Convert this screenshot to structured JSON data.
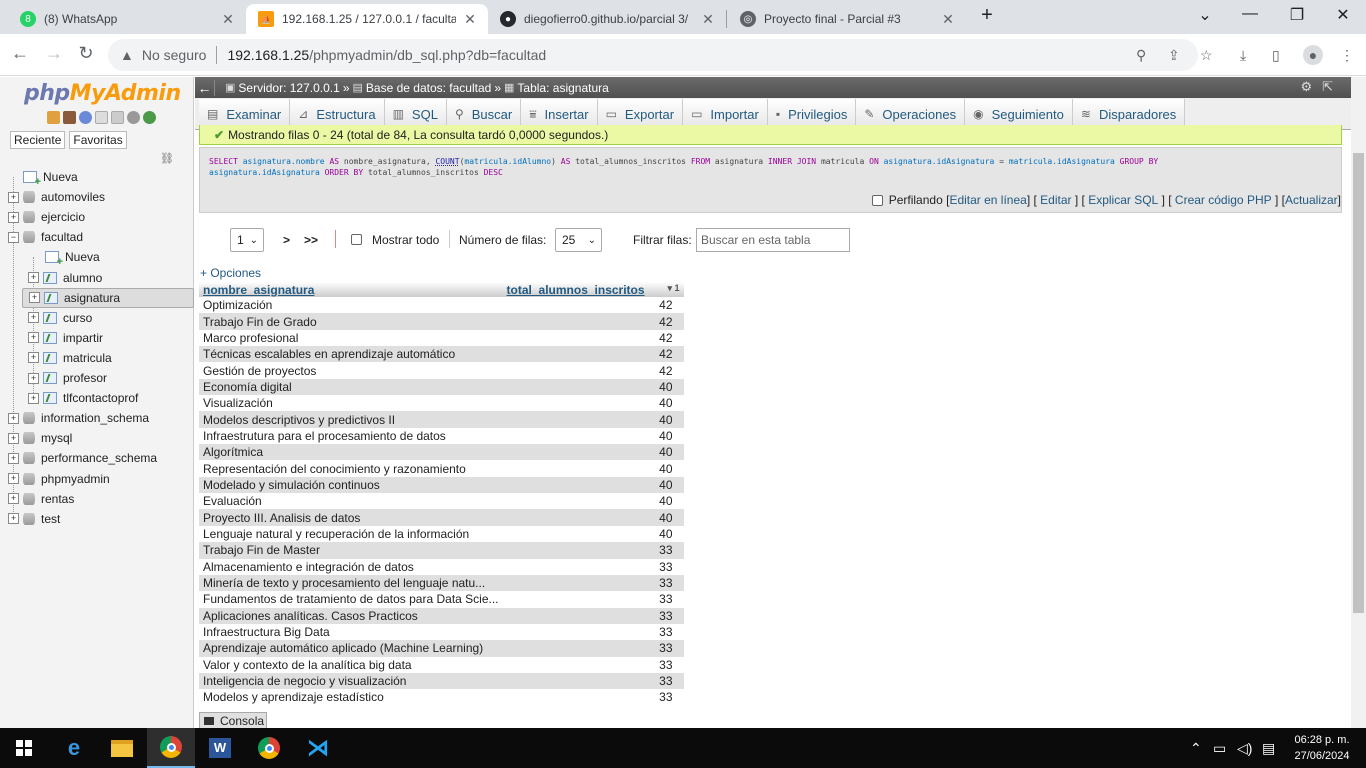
{
  "browser": {
    "tabs": [
      {
        "title": "(8) WhatsApp",
        "icon": "whatsapp-icon"
      },
      {
        "title": "192.168.1.25 / 127.0.0.1 / faculta",
        "icon": "phpmyadmin-icon"
      },
      {
        "title": "diegofierro0.github.io/parcial 3/",
        "icon": "github-icon"
      },
      {
        "title": "Proyecto final - Parcial #3",
        "icon": "globe-icon"
      }
    ],
    "new_tab": "+",
    "address": {
      "security": "No seguro",
      "host": "192.168.1.25",
      "path": "/phpmyadmin/db_sql.php?db=facultad"
    }
  },
  "sidebar": {
    "logo_php": "php",
    "logo_my": "MyAdmin",
    "recent_label": "Reciente",
    "favorites_label": "Favoritas",
    "items": [
      {
        "label": "Nueva",
        "level": 0,
        "kind": "new"
      },
      {
        "label": "automoviles",
        "level": 0,
        "kind": "db"
      },
      {
        "label": "ejercicio",
        "level": 0,
        "kind": "db"
      },
      {
        "label": "facultad",
        "level": 0,
        "kind": "db"
      },
      {
        "label": "Nueva",
        "level": 1,
        "kind": "new"
      },
      {
        "label": "alumno",
        "level": 1,
        "kind": "table"
      },
      {
        "label": "asignatura",
        "level": 1,
        "kind": "table"
      },
      {
        "label": "curso",
        "level": 1,
        "kind": "table"
      },
      {
        "label": "impartir",
        "level": 1,
        "kind": "table"
      },
      {
        "label": "matricula",
        "level": 1,
        "kind": "table"
      },
      {
        "label": "profesor",
        "level": 1,
        "kind": "table"
      },
      {
        "label": "tlfcontactoprof",
        "level": 1,
        "kind": "table"
      },
      {
        "label": "information_schema",
        "level": 0,
        "kind": "db"
      },
      {
        "label": "mysql",
        "level": 0,
        "kind": "db"
      },
      {
        "label": "performance_schema",
        "level": 0,
        "kind": "db"
      },
      {
        "label": "phpmyadmin",
        "level": 0,
        "kind": "db"
      },
      {
        "label": "rentas",
        "level": 0,
        "kind": "db"
      },
      {
        "label": "test",
        "level": 0,
        "kind": "db"
      }
    ]
  },
  "breadcrumb": {
    "server": "Servidor: 127.0.0.1",
    "database": "Base de datos: facultad",
    "table": "Tabla: asignatura",
    "sep": "»"
  },
  "menu": [
    {
      "label": "Examinar",
      "icon": "browse-icon"
    },
    {
      "label": "Estructura",
      "icon": "structure-icon"
    },
    {
      "label": "SQL",
      "icon": "sql-icon"
    },
    {
      "label": "Buscar",
      "icon": "search-icon"
    },
    {
      "label": "Insertar",
      "icon": "insert-icon"
    },
    {
      "label": "Exportar",
      "icon": "export-icon"
    },
    {
      "label": "Importar",
      "icon": "import-icon"
    },
    {
      "label": "Privilegios",
      "icon": "privileges-icon"
    },
    {
      "label": "Operaciones",
      "icon": "operations-icon"
    },
    {
      "label": "Seguimiento",
      "icon": "tracking-icon"
    },
    {
      "label": "Disparadores",
      "icon": "triggers-icon"
    }
  ],
  "message": "Mostrando filas 0 - 24 (total de 84, La consulta tardó 0,0000 segundos.)",
  "sql": {
    "line1": "SELECT asignatura.nombre AS nombre_asignatura, COUNT(matricula.idAlumno) AS total_alumnos_inscritos FROM asignatura INNER JOIN matricula ON asignatura.idAsignatura = matricula.idAsignatura GROUP BY",
    "line2": "asignatura.idAsignatura ORDER BY total_alumnos_inscritos DESC"
  },
  "sqltools": {
    "profiling": "Perfilando",
    "edit_inline": "Editar en línea",
    "edit": "Editar",
    "explain": "Explicar SQL",
    "php_code": "Crear código PHP",
    "refresh": "Actualizar"
  },
  "pagination": {
    "page": "1",
    "next": ">",
    "last": ">>",
    "show_all": "Mostrar todo",
    "rows_label": "Número de filas:",
    "rows_value": "25",
    "filter_label": "Filtrar filas:",
    "filter_placeholder": "Buscar en esta tabla"
  },
  "options_link": "+ Opciones",
  "table": {
    "columns": [
      "nombre_asignatura",
      "total_alumnos_inscritos"
    ],
    "sort_indicator": "1",
    "rows": [
      [
        "Optimización",
        "42"
      ],
      [
        "Trabajo Fin de Grado",
        "42"
      ],
      [
        "Marco profesional",
        "42"
      ],
      [
        "Técnicas escalables en aprendizaje automático",
        "42"
      ],
      [
        "Gestión de proyectos",
        "42"
      ],
      [
        "Economía digital",
        "40"
      ],
      [
        "Visualización",
        "40"
      ],
      [
        "Modelos descriptivos y predictivos II",
        "40"
      ],
      [
        "Infraestrutura para el procesamiento de datos",
        "40"
      ],
      [
        "Algorítmica",
        "40"
      ],
      [
        "Representación del conocimiento y razonamiento",
        "40"
      ],
      [
        "Modelado y simulación continuos",
        "40"
      ],
      [
        "Evaluación",
        "40"
      ],
      [
        "Proyecto III. Analisis de datos",
        "40"
      ],
      [
        "Lenguaje natural y recuperación de la información",
        "40"
      ],
      [
        "Trabajo Fin de Master",
        "33"
      ],
      [
        "Almacenamiento e integración de datos",
        "33"
      ],
      [
        "Minería de texto y procesamiento del lenguaje natu...",
        "33"
      ],
      [
        "Fundamentos de tratamiento de datos para Data Scie...",
        "33"
      ],
      [
        "Aplicaciones analíticas. Casos Practicos",
        "33"
      ],
      [
        "Infraestructura Big Data",
        "33"
      ],
      [
        "Aprendizaje automático aplicado (Machine Learning)",
        "33"
      ],
      [
        "Valor y contexto de la analítica big data",
        "33"
      ],
      [
        "Inteligencia de negocio y visualización",
        "33"
      ],
      [
        "Modelos y aprendizaje estadístico",
        "33"
      ]
    ]
  },
  "console_label": "Consola",
  "taskbar": {
    "time": "06:28 p. m.",
    "date": "27/06/2024"
  }
}
